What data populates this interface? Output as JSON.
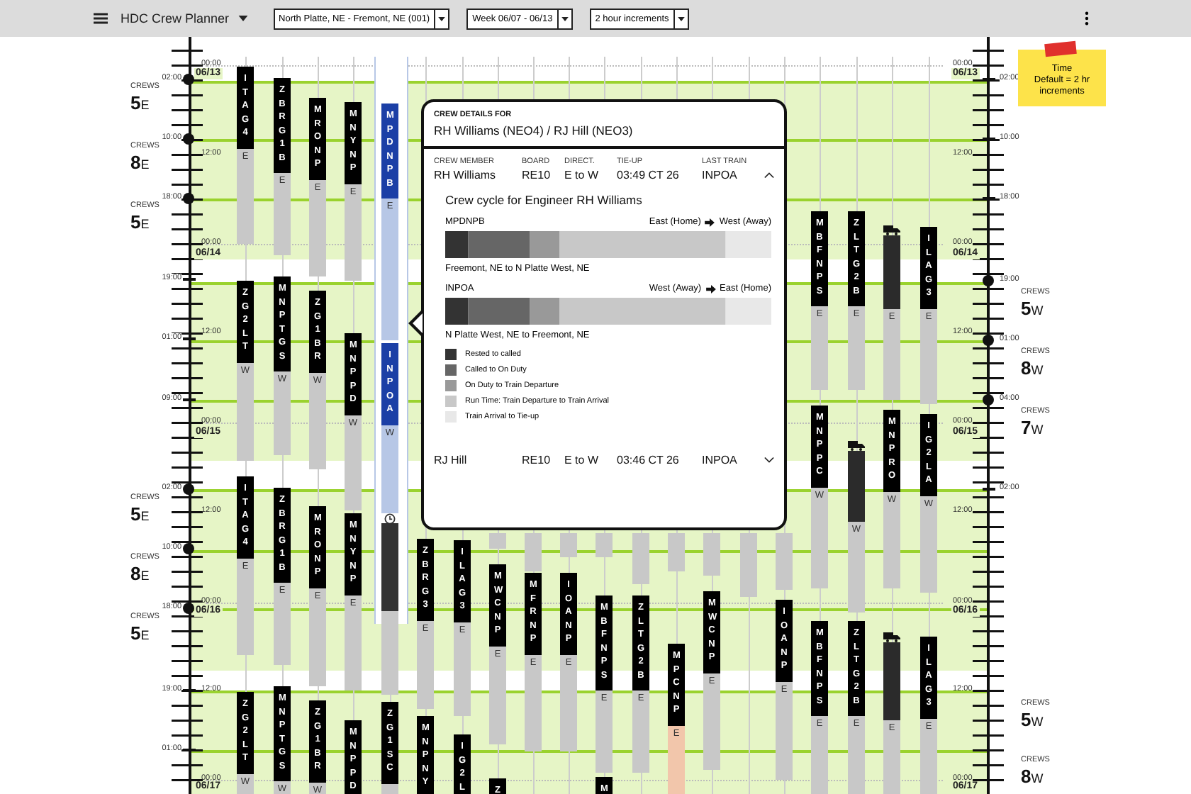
{
  "header": {
    "title": "HDC Crew Planner",
    "filters": [
      {
        "value": "North Platte, NE - Fremont, NE (001)"
      },
      {
        "value": "Week 06/07 - 06/13"
      },
      {
        "value": "2 hour increments"
      }
    ]
  },
  "note": {
    "text": "Time\nDefault = 2 hr\nincrements"
  },
  "left_axis": {
    "outer": [
      {
        "label": "02:00",
        "dot": true
      },
      {
        "label": "10:00",
        "dot": true
      },
      {
        "label": "18:00",
        "dot": true
      },
      {
        "label": "19:00",
        "dot": false
      },
      {
        "label": "01:00",
        "dot": false
      },
      {
        "label": "09:00",
        "dot": false
      },
      {
        "label": "02:00",
        "dot": true
      },
      {
        "label": "10:00",
        "dot": true
      },
      {
        "label": "18:00",
        "dot": true
      },
      {
        "label": "19:00",
        "dot": false
      },
      {
        "label": "01:00",
        "dot": false
      }
    ],
    "inner": [
      "00:00",
      "12:00",
      "00:00",
      "12:00",
      "00:00",
      "12:00",
      "00:00",
      "12:00",
      "00:00"
    ],
    "dates": [
      "06/13",
      "06/14",
      "06/15",
      "06/16",
      "06/17"
    ],
    "counts": [
      {
        "caption": "CREWS",
        "count": "5",
        "direction": "E"
      },
      {
        "caption": "CREWS",
        "count": "8",
        "direction": "E"
      },
      {
        "caption": "CREWS",
        "count": "5",
        "direction": "E"
      },
      {
        "caption": "CREWS",
        "count": "5",
        "direction": "E"
      },
      {
        "caption": "CREWS",
        "count": "8",
        "direction": "E"
      },
      {
        "caption": "CREWS",
        "count": "5",
        "direction": "E"
      }
    ]
  },
  "right_axis": {
    "outer": [
      {
        "label": "02:00",
        "dot": false
      },
      {
        "label": "10:00",
        "dot": false
      },
      {
        "label": "18:00",
        "dot": false
      },
      {
        "label": "19:00",
        "dot": true
      },
      {
        "label": "01:00",
        "dot": true
      },
      {
        "label": "04:00",
        "dot": true
      },
      {
        "label": "02:00",
        "dot": false
      }
    ],
    "inner": [
      "00:00",
      "12:00",
      "00:00",
      "12:00",
      "00:00",
      "12:00",
      "00:00",
      "12:00",
      "00:00"
    ],
    "dates": [
      "06/13",
      "06/14",
      "06/15",
      "06/16",
      "06/17"
    ],
    "counts": [
      {
        "caption": "CREWS",
        "count": "5",
        "direction": "W"
      },
      {
        "caption": "CREWS",
        "count": "8",
        "direction": "W"
      },
      {
        "caption": "CREWS",
        "count": "7",
        "direction": "W"
      },
      {
        "caption": "CREWS",
        "count": "5",
        "direction": "W"
      },
      {
        "caption": "CREWS",
        "count": "8",
        "direction": "W"
      }
    ]
  },
  "trains": [
    {
      "label": "ITAG4",
      "direction": "E",
      "kind": "crew"
    },
    {
      "label": "ZG2LT",
      "direction": "W",
      "kind": "crew"
    },
    {
      "label": "ITAG4",
      "direction": "E",
      "kind": "crew"
    },
    {
      "label": "ZG2LT",
      "direction": "W",
      "kind": "crew"
    },
    {
      "label": "ZBRG1B",
      "direction": "E",
      "kind": "crew"
    },
    {
      "label": "MNPTGS",
      "direction": "W",
      "kind": "crew"
    },
    {
      "label": "ZBRG1B",
      "direction": "E",
      "kind": "crew"
    },
    {
      "label": "MNPTGS",
      "direction": "W",
      "kind": "crew"
    },
    {
      "label": "MRONP",
      "direction": "E",
      "kind": "crew"
    },
    {
      "label": "ZG1BR",
      "direction": "W",
      "kind": "crew"
    },
    {
      "label": "MRONP",
      "direction": "E",
      "kind": "crew"
    },
    {
      "label": "ZG1BR",
      "direction": "W",
      "kind": "crew"
    },
    {
      "label": "MNYNP",
      "direction": "E",
      "kind": "crew"
    },
    {
      "label": "MNPPD",
      "direction": "W",
      "kind": "crew"
    },
    {
      "label": "MNYNP",
      "direction": "E",
      "kind": "crew"
    },
    {
      "label": "MNPPD",
      "kind": "crew"
    },
    {
      "label": "MPDNPB",
      "direction": "E",
      "kind": "selected"
    },
    {
      "label": "INPOA",
      "direction": "W",
      "kind": "selected"
    },
    {
      "kind": "held"
    },
    {
      "label": "ZG1SC",
      "kind": "crew"
    },
    {
      "label": "ZBRG3",
      "direction": "E",
      "kind": "crew"
    },
    {
      "label": "MNPNY",
      "kind": "crew"
    },
    {
      "label": "ILAG3",
      "direction": "E",
      "kind": "crew"
    },
    {
      "label": "IG2L",
      "kind": "crew"
    },
    {
      "label": "MWCNP",
      "direction": "E",
      "kind": "crew"
    },
    {
      "label": "Z",
      "kind": "crew"
    },
    {
      "label": "MFRNP",
      "direction": "E",
      "kind": "crew"
    },
    {
      "label": "IOANP",
      "direction": "E",
      "kind": "crew"
    },
    {
      "label": "MBFNPS",
      "direction": "E",
      "kind": "crew"
    },
    {
      "label": "M",
      "kind": "crew"
    },
    {
      "label": "ZLTG2B",
      "direction": "E",
      "kind": "crew"
    },
    {
      "label": "MPCNP",
      "direction": "E",
      "kind": "delayed"
    },
    {
      "label": "MWCNP",
      "direction": "E",
      "kind": "crew"
    },
    {
      "label": "IOANP",
      "direction": "E",
      "kind": "crew"
    },
    {
      "label": "MBFNPS",
      "direction": "E",
      "kind": "crew"
    },
    {
      "label": "MNPPC",
      "direction": "W",
      "kind": "crew"
    },
    {
      "label": "MBFNPS",
      "direction": "E",
      "kind": "crew"
    },
    {
      "label": "ZLTG2B",
      "direction": "E",
      "kind": "crew"
    },
    {
      "direction": "W",
      "kind": "engine"
    },
    {
      "label": "ZLTG2B",
      "direction": "E",
      "kind": "crew"
    },
    {
      "direction": "E",
      "kind": "engine"
    },
    {
      "label": "MNPRO",
      "direction": "W",
      "kind": "crew"
    },
    {
      "direction": "E",
      "kind": "engine"
    },
    {
      "label": "ILAG3",
      "direction": "E",
      "kind": "crew"
    },
    {
      "label": "IG2LA",
      "direction": "W",
      "kind": "crew"
    },
    {
      "label": "ILAG3",
      "direction": "E",
      "kind": "crew"
    }
  ],
  "popup": {
    "heading": "CREW DETAILS FOR",
    "title": "RH Williams (NEO4) / RJ Hill (NEO3)",
    "columns": [
      "CREW MEMBER",
      "BOARD",
      "DIRECT.",
      "TIE-UP",
      "LAST TRAIN"
    ],
    "members": [
      {
        "name": "RH Williams",
        "board": "RE10",
        "direct": "E to W",
        "tie_up": "03:49 CT 26",
        "last_train": "INPOA",
        "expanded": true,
        "cycle": {
          "title": "Crew cycle for Engineer RH Williams",
          "legs": [
            {
              "train": "MPDNPB",
              "from": "East (Home)",
              "to": "West (Away)",
              "route": "Freemont, NE to N Platte West, NE"
            },
            {
              "train": "INPOA",
              "from": "West (Away)",
              "to": "East (Home)",
              "route": "N Platte West, NE to Freemont, NE"
            }
          ]
        }
      },
      {
        "name": "RJ Hill",
        "board": "RE10",
        "direct": "E to W",
        "tie_up": "03:46 CT 26",
        "last_train": "INPOA",
        "expanded": false
      }
    ],
    "legend": [
      {
        "label": "Rested to called",
        "color": "#333333"
      },
      {
        "label": "Called to On Duty",
        "color": "#666666"
      },
      {
        "label": "On Duty to Train Departure",
        "color": "#999999"
      },
      {
        "label": "Run Time: Train Departure to Train Arrival",
        "color": "#c8c8c8"
      },
      {
        "label": "Train Arrival to Tie-up",
        "color": "#e8e8e8"
      }
    ]
  }
}
